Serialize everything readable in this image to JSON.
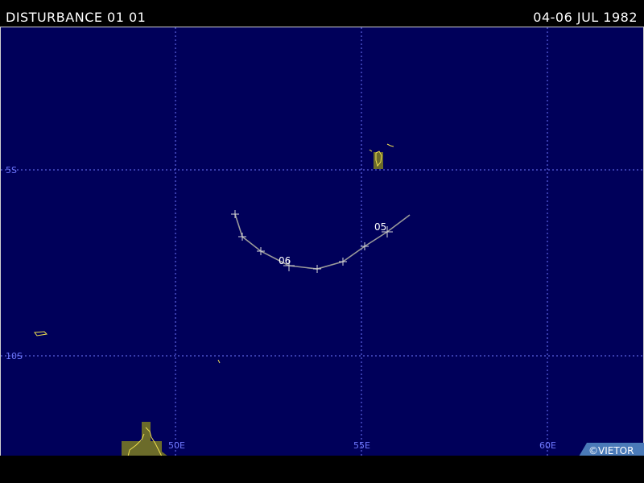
{
  "header": {
    "title": "DISTURBANCE 01 01",
    "date_range": "04-06 JUL 1982"
  },
  "map": {
    "lat_labels": [
      "5S",
      "10S"
    ],
    "lon_labels": [
      "50E",
      "55E",
      "60E"
    ],
    "track_day_labels": [
      "05",
      "06"
    ],
    "credit": "©VIETOR",
    "colors": {
      "ocean": "#00005a",
      "land": "#6b6b2a",
      "coast": "#f0e050",
      "grid": "#6f78ff",
      "track": "#9a9a9a"
    }
  }
}
